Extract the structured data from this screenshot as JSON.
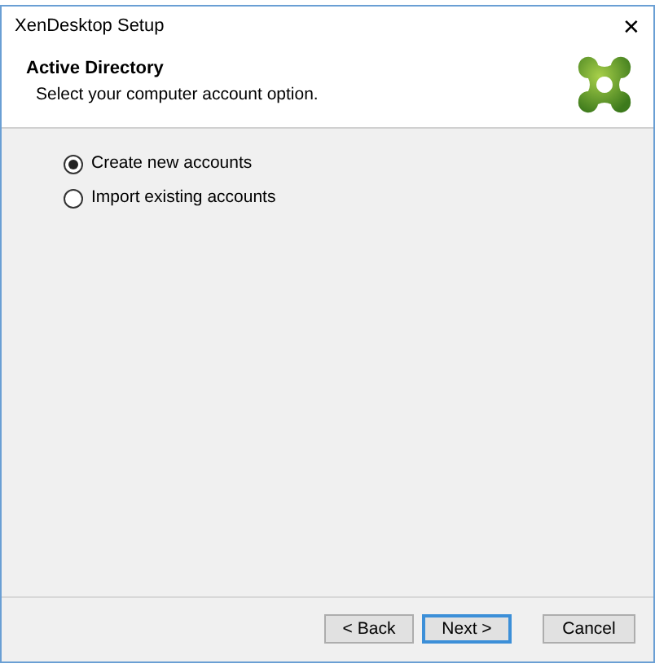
{
  "window": {
    "title": "XenDesktop Setup",
    "close": "✕"
  },
  "header": {
    "title": "Active Directory",
    "subtitle": "Select your computer account option."
  },
  "options": [
    {
      "label": "Create new accounts",
      "selected": true
    },
    {
      "label": "Import existing accounts",
      "selected": false
    }
  ],
  "buttons": [
    {
      "label": "< Back",
      "default": false
    },
    {
      "label": "Next >",
      "default": true
    },
    {
      "label": "Cancel",
      "default": false
    }
  ]
}
